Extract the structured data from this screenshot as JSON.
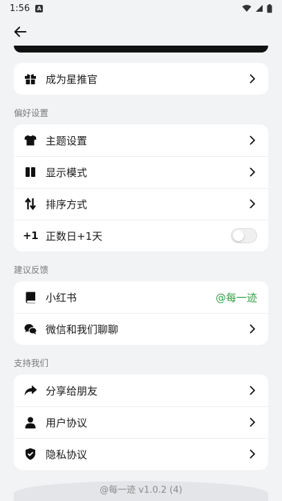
{
  "status_bar": {
    "time": "1:56"
  },
  "nav": {
    "back": "back"
  },
  "card_recommend": {
    "items": [
      {
        "label": "成为星推官",
        "icon": "gift-icon"
      }
    ]
  },
  "section_preferences": {
    "title": "偏好设置",
    "items": [
      {
        "label": "主题设置",
        "icon": "tshirt-icon"
      },
      {
        "label": "显示模式",
        "icon": "columns-icon"
      },
      {
        "label": "排序方式",
        "icon": "sort-icon"
      },
      {
        "label": "正数日+1天",
        "icon_text": "+1",
        "toggle": false
      }
    ]
  },
  "section_feedback": {
    "title": "建议反馈",
    "items": [
      {
        "label": "小红书",
        "icon": "book-icon",
        "value": "@每一迹"
      },
      {
        "label": "微信和我们聊聊",
        "icon": "wechat-icon"
      }
    ]
  },
  "section_support": {
    "title": "支持我们",
    "items": [
      {
        "label": "分享给朋友",
        "icon": "share-icon"
      },
      {
        "label": "用户协议",
        "icon": "user-icon"
      },
      {
        "label": "隐私协议",
        "icon": "shield-icon"
      }
    ]
  },
  "footer": {
    "version": "@每一迹 v1.0.2 (4)"
  },
  "colors": {
    "accent_green": "#2e9e3f",
    "background": "#f2f3f5"
  }
}
